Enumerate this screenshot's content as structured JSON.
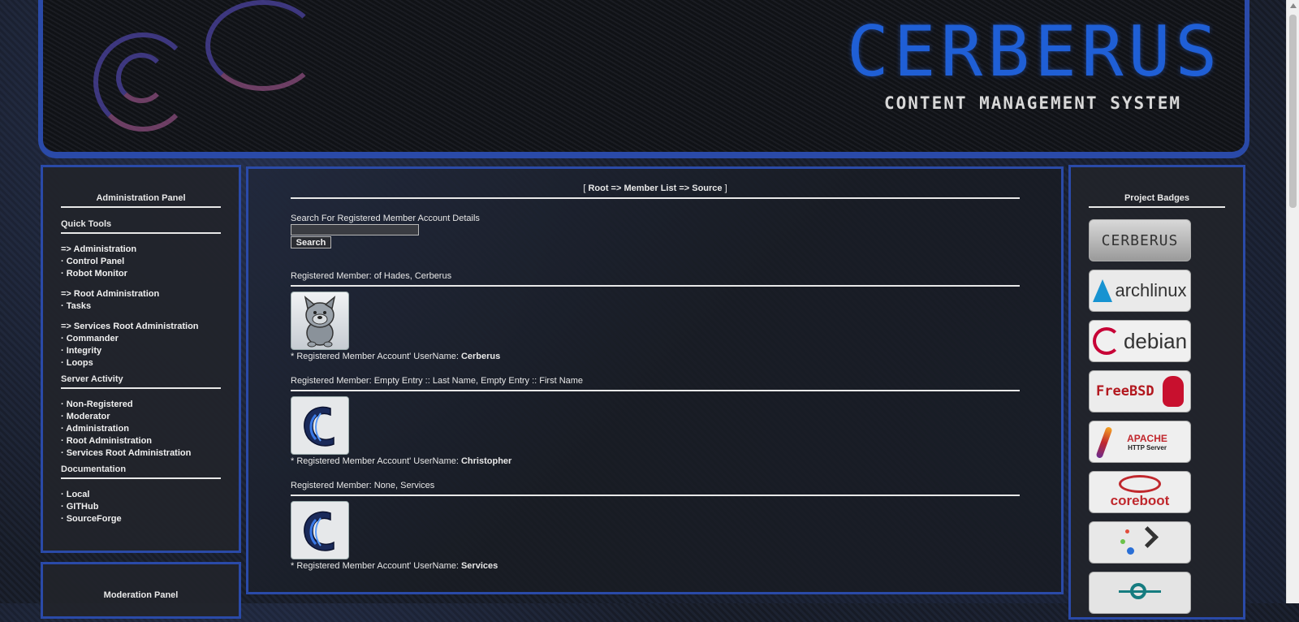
{
  "banner": {
    "title": "CERBERUS",
    "subtitle": "CONTENT MANAGEMENT SYSTEM"
  },
  "admin_panel": {
    "title": "Administration Panel",
    "quick_tools": {
      "title": "Quick Tools",
      "groups": [
        [
          "=> Administration",
          "· Control Panel",
          "· Robot Monitor"
        ],
        [
          "=> Root Administration",
          "· Tasks"
        ],
        [
          "=> Services Root Administration",
          "· Commander",
          "· Integrity",
          "· Loops"
        ]
      ]
    },
    "server_activity": {
      "title": "Server Activity",
      "items": [
        "· Non-Registered",
        "· Moderator",
        "· Administration",
        "· Root Administration",
        "· Services Root Administration"
      ]
    },
    "documentation": {
      "title": "Documentation",
      "items": [
        "· Local",
        "· GITHub",
        "· SourceForge"
      ]
    }
  },
  "moderation_panel": {
    "title": "Moderation Panel"
  },
  "main": {
    "breadcrumb": {
      "open": "[",
      "root": "Root",
      "sep1": "=>",
      "member_list": "Member List",
      "sep2": "=>",
      "source": "Source",
      "close": "]"
    },
    "search": {
      "label": "Search For Registered Member Account Details",
      "value": "",
      "button": "Search"
    },
    "members": [
      {
        "heading": "Registered Member: of Hades, Cerberus",
        "prefix": "* Registered Member Account' UserName:",
        "username": "Cerberus",
        "avatar_icon": "wolf-avatar-icon"
      },
      {
        "heading": "Registered Member: Empty Entry :: Last Name, Empty Entry :: First Name",
        "prefix": "* Registered Member Account' UserName:",
        "username": "Christopher",
        "avatar_icon": "c-logo-avatar-icon"
      },
      {
        "heading": "Registered Member: None, Services",
        "prefix": "* Registered Member Account' UserName:",
        "username": "Services",
        "avatar_icon": "c-logo-avatar-icon"
      }
    ]
  },
  "badges_panel": {
    "title": "Project Badges",
    "badges": [
      {
        "name": "cerberus-badge",
        "text": "CERBERUS"
      },
      {
        "name": "archlinux-badge",
        "text": "archlinux"
      },
      {
        "name": "debian-badge",
        "text": "debian"
      },
      {
        "name": "freebsd-badge",
        "text": "FreeBSD"
      },
      {
        "name": "apache-badge",
        "text": "APACHE",
        "text2": "HTTP Server"
      },
      {
        "name": "coreboot-badge",
        "text": "coreboot"
      },
      {
        "name": "shell-badge",
        "text": ""
      },
      {
        "name": "lineage-badge",
        "text": ""
      }
    ]
  },
  "colors": {
    "accent_border": "#2a4aa8",
    "banner_title": "#1f5fd6",
    "text": "#e8e8e8"
  }
}
